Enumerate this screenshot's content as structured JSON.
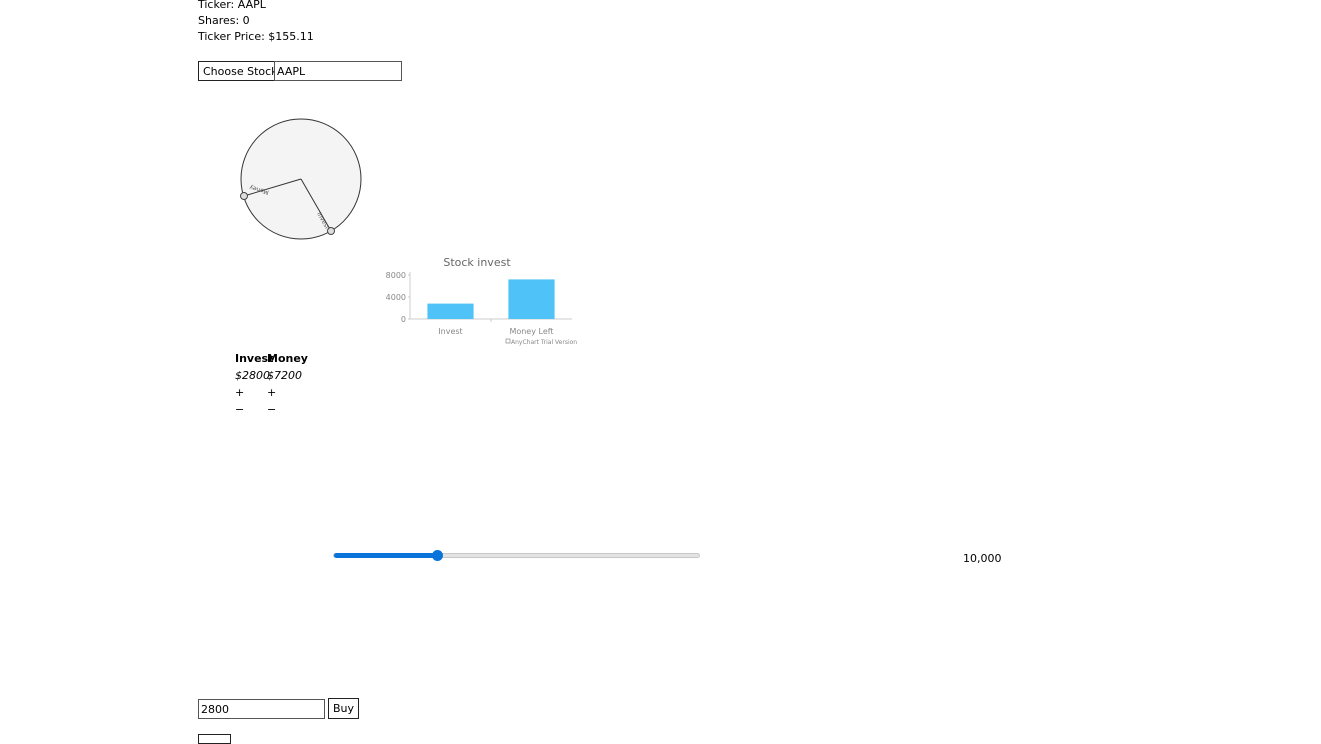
{
  "info": {
    "ticker": "Ticker: AAPL",
    "shares": "Shares: 0",
    "price": "Ticker Price: $155.11"
  },
  "stock_picker": {
    "button_label": "Choose Stock",
    "input_value": "AAPL"
  },
  "dial": {
    "label_money": "Money",
    "label_invest": "Invest"
  },
  "chart_data": {
    "type": "bar",
    "title": "Stock invest",
    "categories": [
      "Invest",
      "Money Left"
    ],
    "values": [
      2800,
      7200
    ],
    "ylim": [
      0,
      8000
    ],
    "yticks": [
      "8000",
      "4000",
      "0"
    ],
    "bar_color": "#4fc3f7",
    "credit": "AnyChart Trial Version"
  },
  "allocation": {
    "headers": [
      "Invest",
      "Money"
    ],
    "amounts": [
      "$2800",
      "$7200"
    ],
    "plus": "+",
    "minus": "−"
  },
  "slider": {
    "fraction": 0.28,
    "max_label": "10,000"
  },
  "buy": {
    "input_value": "2800",
    "button_label": "Buy"
  }
}
